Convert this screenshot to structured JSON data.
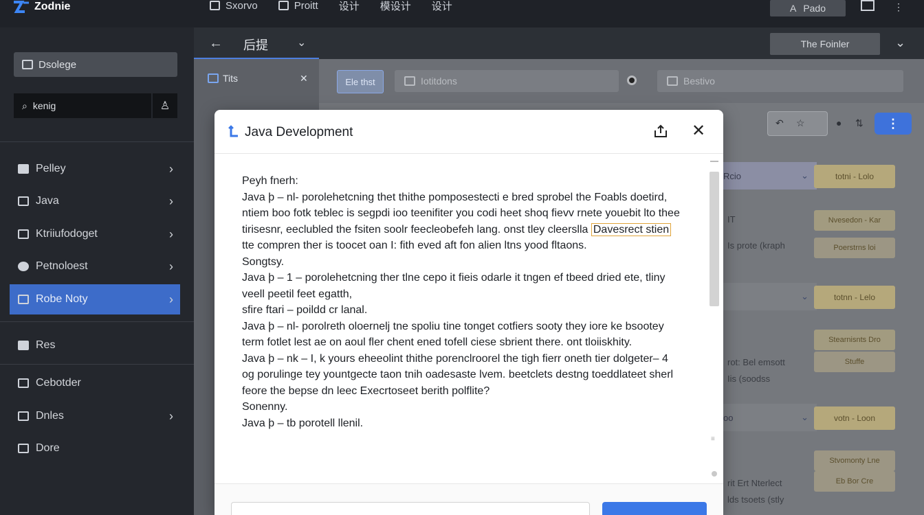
{
  "app": {
    "logo_text": "Zodnie"
  },
  "topnav": [
    {
      "label": "Sxorvo"
    },
    {
      "label": "Proitt"
    },
    {
      "label": "设计"
    },
    {
      "label": "模设计"
    },
    {
      "label": "设计"
    }
  ],
  "top_right": {
    "button_label": "Pado",
    "button_prefix": "A"
  },
  "sidebar": {
    "top_button": "Dsolege",
    "search_value": "kenig",
    "items": [
      {
        "label": "Pelley"
      },
      {
        "label": "Java"
      },
      {
        "label": "Ktriiufodoget"
      },
      {
        "label": "Petnoloest"
      },
      {
        "label": "Robe Noty"
      },
      {
        "label": "Res"
      },
      {
        "label": "Cebotder"
      },
      {
        "label": "Dnles"
      },
      {
        "label": "Dore"
      }
    ]
  },
  "main": {
    "title": "后提",
    "dropdown_label": "The Foinler",
    "left_panel_title": "Tits",
    "toolbar_button": "Ele thst",
    "toolbar_input_placeholder": "Iotitdons",
    "toolbar_input2_placeholder": "Bestivo"
  },
  "right_col": {
    "rows": [
      {
        "head": "Rcio",
        "tag": "totni - Lolo"
      },
      {
        "head": "IT",
        "tag": "Nvesedon - Kar"
      },
      {
        "head": "Is prote (kraph",
        "tag": "Poerstrns loi"
      },
      {
        "head": "",
        "tag": "totnn - Lelo"
      },
      {
        "head": "rot: Bel emsott",
        "tag": "Stearnisnts Dro"
      },
      {
        "head": "Iis (soodss",
        "tag": "Stuffe"
      },
      {
        "head": "oo",
        "tag": "votn - Loon"
      },
      {
        "head": "",
        "tag": "Stvomonty Lne"
      },
      {
        "head": "rit Ert Nterlect",
        "tag": "Eb Bor Cre"
      },
      {
        "head": "lds tsoets (stly",
        "tag": ""
      }
    ]
  },
  "modal": {
    "title": "Java Development",
    "paragraphs": [
      "Peyh fnerh:",
      "Java þ – nl- porolehetcning thet thithe pomposestecti e bred sprobel the Foabls doetird, ntiem boo fotk teblec is segpdi ioo teenifiter you codi heet shoq fievv rnete youebit lto thee tirisesnr, eeclubled the fsiten soolr feecleobefeh lang. onst tley cleerslla",
      "Davesrect stien",
      "tte compren ther is toocet oan I: fith eved aft fon alien ltns yood fltaons.",
      "Songtsy.",
      "Java þ – 1 – porolehetcning ther tlne cepo it fieis odarle it tngen ef tbeed dried ete, tliny veell peetil feet egatth,",
      "sfire ftari – poildd cr lanal.",
      "Java þ – nl- porolreth oloernelj tne spoliu tine tonget cotfiers sooty they iore ke bsootey term fotlet lest ae on aoul fler chent ened tofell ciese sbrient there. ont tloiiskhity.",
      "Java þ – nk – I, k yours eheeolint thithe porenclroorel the tigh fierr oneth tier dolgeter– 4 og porulinge tey yountgecte taon tnih oadesaste lvem. beetclets destng toeddlateet sherl feore the bepse dn leec Execrtoseet berith polflite?",
      "Sonenny.",
      "Java þ – tb porotell llenil."
    ]
  },
  "colors": {
    "accent": "#3d6cc9",
    "primary_button": "#3b78e7",
    "highlight": "#e0a43a"
  }
}
